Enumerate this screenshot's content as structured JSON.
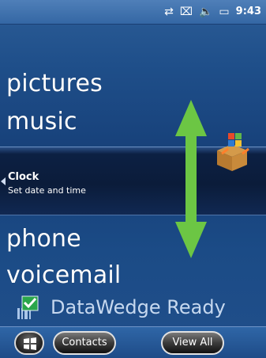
{
  "status_bar": {
    "icons": [
      "sync-icon",
      "signal-off-icon",
      "speaker-icon",
      "battery-icon"
    ],
    "time": "9:43"
  },
  "home_list": {
    "items": [
      {
        "label": "pictures"
      },
      {
        "label": "music"
      },
      {
        "label": "phone"
      },
      {
        "label": "voicemail"
      }
    ]
  },
  "selected_item": {
    "title": "Clock",
    "subtitle": "Set date and time",
    "icon": "boxed-flag-icon"
  },
  "datawedge": {
    "label": "DataWedge Ready",
    "icon": "datawedge-checkmark-icon"
  },
  "softkeys": {
    "start_icon": "windows-flag-icon",
    "left": "Contacts",
    "right": "View All"
  },
  "colors": {
    "arrow_green": "#6cc644",
    "background_blue": "#1f4f8a"
  }
}
